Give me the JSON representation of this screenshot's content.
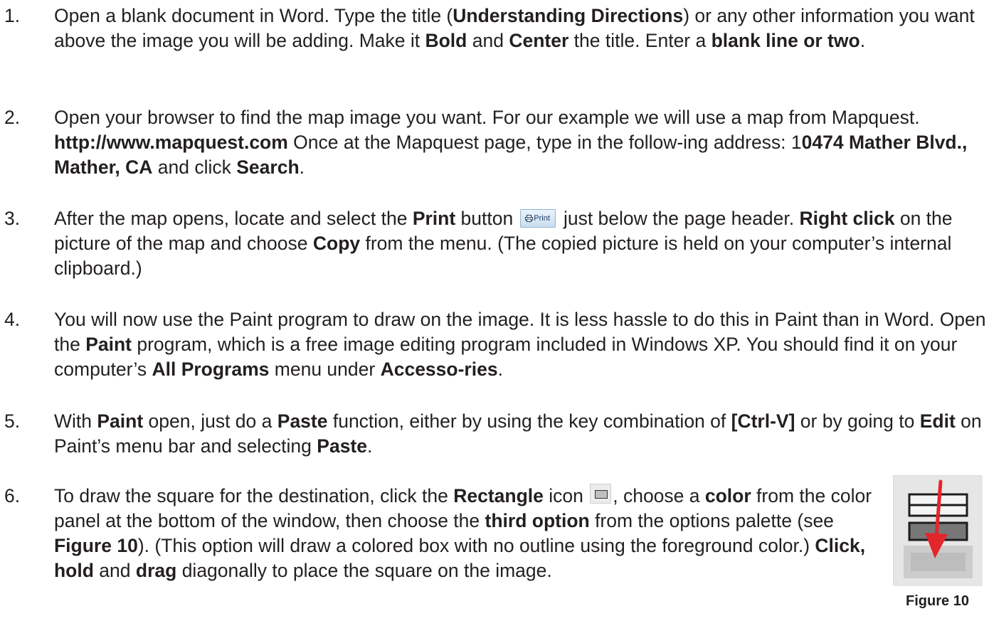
{
  "steps": [
    {
      "number": "1.",
      "parts": [
        "Open a blank document in Word. Type the title (",
        "Understanding Directions",
        ") or any other information you want above the image you will be adding. Make it ",
        "Bold",
        " and ",
        "Center",
        " the title. Enter a ",
        "blank line or two",
        "."
      ]
    },
    {
      "number": "2.",
      "parts": [
        "Open your browser to find the map image you want. For our example we will use a map from Mapquest. ",
        "http://www.mapquest.com",
        " Once at the Mapquest page, type in the follow-ing address:  1",
        "0474 Mather Blvd., Mather, CA",
        "  and click ",
        "Search",
        "."
      ]
    },
    {
      "number": "3.",
      "parts": [
        "After the map opens, locate and select the ",
        "Print",
        " button ",
        " just below the page header. ",
        "Right click",
        " on the picture of the map and choose ",
        "Copy",
        " from the menu. (The copied picture is held on your computer’s internal clipboard.)"
      ],
      "print_button_label": "Print"
    },
    {
      "number": "4.",
      "parts": [
        "You will now use the Paint program to draw on the image. It is less hassle to do this in Paint than in Word. Open the ",
        "Paint",
        " program, which is a free image editing program included in Windows XP. You should find it on your computer’s ",
        "All Programs",
        " menu under ",
        "Accesso-ries",
        "."
      ]
    },
    {
      "number": "5.",
      "parts": [
        "With ",
        "Paint",
        " open, just do a ",
        "Paste",
        " function, either by using the key combination of ",
        "[Ctrl-V]",
        " or by going to ",
        "Edit",
        " on Paint’s menu bar and selecting ",
        "Paste",
        "."
      ]
    },
    {
      "number": "6.",
      "parts": [
        "To draw the square for the destination, click the ",
        "Rectangle",
        " icon ",
        ", choose a ",
        "color",
        " from the color panel at the bottom of the window, then choose the ",
        "third option",
        " from the options palette (see ",
        "Figure 10",
        "). (This option will draw a colored box with no outline using the foreground color.) ",
        "Click, hold",
        " and ",
        "drag",
        " diagonally to place the square on the image."
      ]
    }
  ],
  "figure": {
    "caption": "Figure 10",
    "icons": [
      "rectangle-outline-option-icon",
      "rectangle-filled-outline-option-icon",
      "rectangle-filled-no-outline-option-icon",
      "red-arrow-icon"
    ],
    "arrow_color": "#e3262b"
  },
  "colors": {
    "text": "#231f20",
    "background": "#ffffff"
  }
}
